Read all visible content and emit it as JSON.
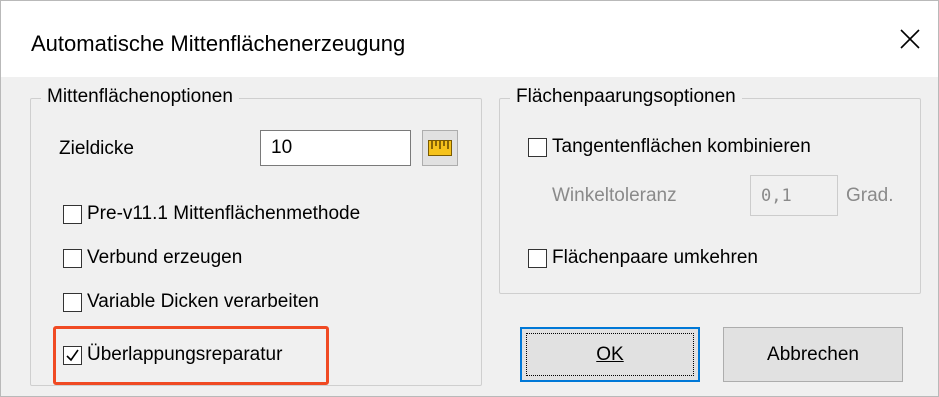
{
  "window": {
    "title": "Automatische Mittenflächenerzeugung",
    "close_symbol": "✕"
  },
  "left_group": {
    "legend": "Mittenflächenoptionen",
    "zieldicke_label": "Zieldicke",
    "zieldicke_value": "10",
    "measure_icon": "ruler-icon",
    "checkboxes": [
      {
        "label": "Pre-v11.1 Mittenflächenmethode",
        "checked": false
      },
      {
        "label": "Verbund erzeugen",
        "checked": false
      },
      {
        "label": "Variable Dicken verarbeiten",
        "checked": false
      },
      {
        "label": "Überlappungsreparatur",
        "checked": true
      }
    ],
    "highlight_color": "#f04a23"
  },
  "right_group": {
    "legend": "Flächenpaarungsoptionen",
    "tangent_checkbox": {
      "label": "Tangentenflächen kombinieren",
      "checked": false
    },
    "winkeltoleranz_label": "Winkeltoleranz",
    "winkeltoleranz_value": "0,1",
    "winkeltoleranz_unit": "Grad.",
    "reverse_checkbox": {
      "label": "Flächenpaare umkehren",
      "checked": false
    }
  },
  "buttons": {
    "ok_label": "OK",
    "cancel_label": "Abbrechen"
  },
  "colors": {
    "accent": "#0078d7",
    "dialog_bg": "#f0f0f0"
  }
}
